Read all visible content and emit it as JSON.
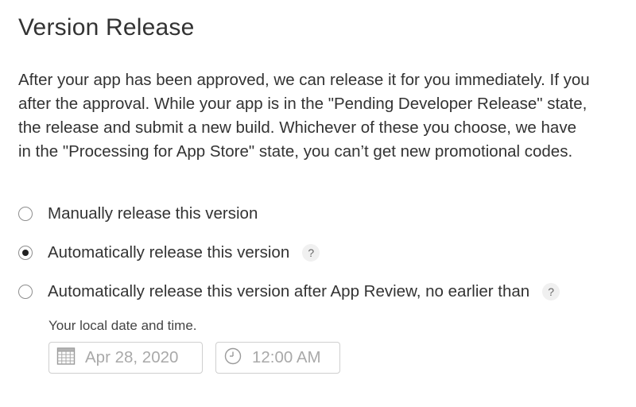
{
  "section": {
    "title": "Version Release",
    "description_lines": [
      "After your app has been approved, we can release it for you immediately. If you",
      "after the approval. While your app is in the \"Pending Developer Release\" state,",
      "the release and submit a new build. Whichever of these you choose, we have",
      "in the \"Processing for App Store\" state, you can’t get new promotional codes."
    ]
  },
  "options": [
    {
      "label": "Manually release this version",
      "checked": false,
      "help": ""
    },
    {
      "label": "Automatically release this version",
      "checked": true,
      "help": "?"
    },
    {
      "label": "Automatically release this version after App Review, no earlier than",
      "checked": false,
      "help": "?"
    }
  ],
  "schedule": {
    "hint": "Your local date and time.",
    "date_value": "Apr 28, 2020",
    "time_value": "12:00 AM",
    "date_icon": "calendar-icon",
    "time_icon": "clock-icon"
  }
}
